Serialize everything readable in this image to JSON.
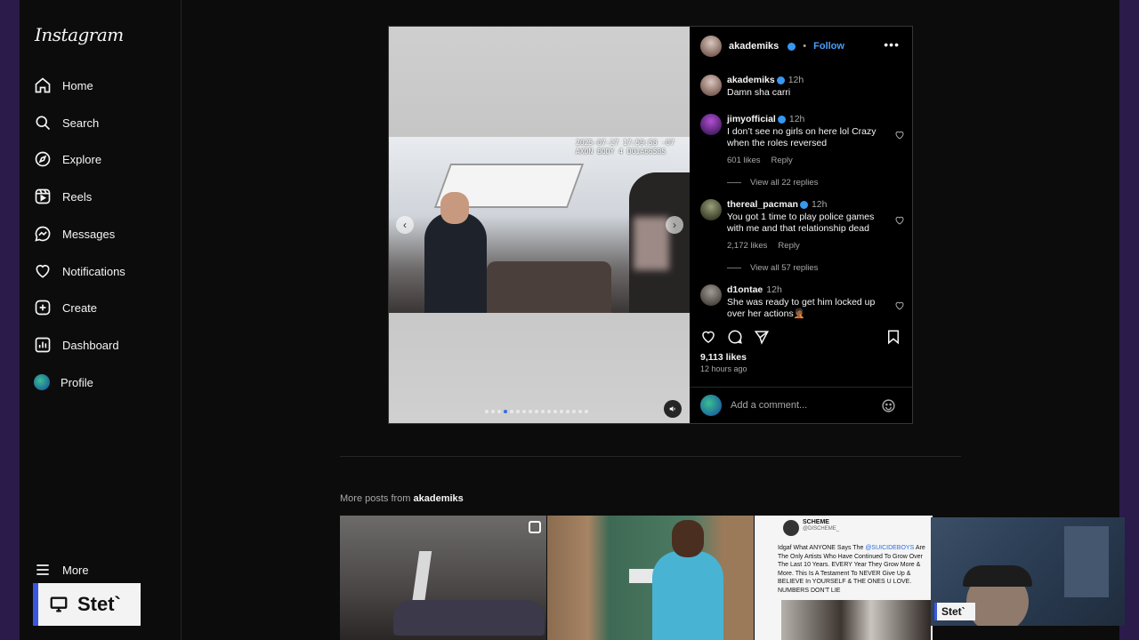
{
  "app": {
    "logo": "Instagram"
  },
  "nav": [
    {
      "label": "Home",
      "icon": "home-icon"
    },
    {
      "label": "Search",
      "icon": "search-icon"
    },
    {
      "label": "Explore",
      "icon": "compass-icon"
    },
    {
      "label": "Reels",
      "icon": "reels-icon"
    },
    {
      "label": "Messages",
      "icon": "messenger-icon"
    },
    {
      "label": "Notifications",
      "icon": "heart-icon"
    },
    {
      "label": "Create",
      "icon": "plus-square-icon"
    },
    {
      "label": "Dashboard",
      "icon": "dashboard-icon"
    },
    {
      "label": "Profile",
      "icon": "avatar"
    }
  ],
  "more": {
    "label": "More",
    "icon": "menu-icon"
  },
  "overlay": {
    "stet_label": "Stet`",
    "stet_small": "Stet`"
  },
  "post": {
    "author": "akademiks",
    "follow_label": "Follow",
    "separator": "•",
    "media_stamp_line1": "2025-07-27 17:59:58 -07",
    "media_stamp_line2": "AXON BODY 4 D01A6658S",
    "carousel_count": 17,
    "carousel_active_index": 3,
    "caption": {
      "user": "akademiks",
      "time": "12h",
      "text": "Damn sha carri"
    },
    "comments": [
      {
        "user": "jimyofficial",
        "verified": true,
        "time": "12h",
        "text": "I don’t see no girls on here lol Crazy when the roles reversed",
        "likes": "601 likes",
        "reply": "Reply",
        "view_replies": "View all 22 replies"
      },
      {
        "user": "thereal_pacman",
        "verified": true,
        "time": "12h",
        "text": "You got 1 time to play police games with me and that relationship dead",
        "likes": "2,172 likes",
        "reply": "Reply",
        "view_replies": "View all 57 replies"
      },
      {
        "user": "d1ontae",
        "verified": false,
        "time": "12h",
        "text": "She was ready to get him locked up over her actions🤦🏾"
      }
    ],
    "likes_count": "9,113 likes",
    "time_ago": "12 hours ago",
    "add_comment_placeholder": "Add a comment..."
  },
  "more_posts": {
    "prefix": "More posts from",
    "user": "akademiks",
    "thumb3": {
      "account": "SCHEME",
      "handle": "@DISCHEME_",
      "text_before": "Idgaf What ANYONE Says The ",
      "highlight": "@SUICIDEBOYS",
      "text_after": " Are The Only Artists Who Have Continued To Grow Over The Last 10 Years. EVERY Year They Grow More & More. This Is A Testament To NEVER Give Up & BELIEVE In YOURSELF & THE ONES U LOVE. NUMBERS DON'T LIE"
    }
  },
  "colors": {
    "accent": "#3897f0",
    "follow": "#4a9ef8",
    "background": "#0c0c0c",
    "stet_bar": "#3a56e0"
  }
}
